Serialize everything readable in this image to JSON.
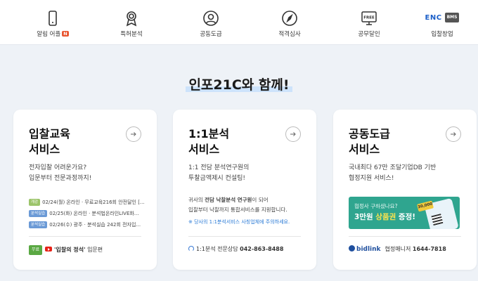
{
  "nav": {
    "items": [
      {
        "label": "알림 어플",
        "badge": "N",
        "icon": "smartphone-icon"
      },
      {
        "label": "특허분석",
        "icon": "award-icon"
      },
      {
        "label": "공동도급",
        "icon": "user-icon"
      },
      {
        "label": "적격심사",
        "icon": "compass-icon"
      },
      {
        "label": "공무달인",
        "icon": "monitor-free-icon",
        "icon_text": "FREE"
      },
      {
        "label": "입찰창업",
        "logo_text": "ENC",
        "logo_sub": "BMS"
      }
    ]
  },
  "section_title": "인포21C와 함께!",
  "cards": [
    {
      "title": "입찰교육\n서비스",
      "desc": "전자입찰 어려운가요?\n입문부터 전문과정까지!",
      "schedule": [
        {
          "tag": "개강",
          "text": "02/24(월) 온라인 · 무료교육216회 안전달인 [..."
        },
        {
          "tag": "분석실습",
          "text": "02/25(화) 온라인 · 분석법온라인LIVE화..."
        },
        {
          "tag": "분석실습",
          "text": "02/26(수) 광주 · 분석실습 242회 전자입..."
        }
      ],
      "footer": {
        "badge": "무료",
        "bold": "'입찰의 정석'",
        "text": " 입문편"
      }
    },
    {
      "title": "1:1분석\n서비스",
      "desc": "1:1 전담 분석연구원의\n투찰금액제시 컨설팅!",
      "para_prefix": "귀사의 ",
      "para_bold": "전담 낙찰분석 연구원",
      "para_suffix": "이 되어\n입찰부터 낙찰까지 통합서비스를 지원합니다.",
      "notice": "※ 당사의 1:1분석서비스 사칭업체에 주의하세요.",
      "footer": {
        "label": "1:1분석 전문상담",
        "phone": "042-863-8488"
      }
    },
    {
      "title": "공동도급\n서비스",
      "desc": "국내최다 67만 조달기업DB 기반\n협정지원 서비스!",
      "banner": {
        "line1": "협정사 구하셨나요?",
        "line2_pre": "3만원 ",
        "line2_bold": "상품권",
        "line2_post": " 증정!",
        "coin": "30,000"
      },
      "footer": {
        "brand": "bidlink",
        "label": "협정매니저",
        "phone": "1644-7818"
      }
    }
  ],
  "colors": {
    "accent": "#1a5ec8",
    "badge": "#e8542f",
    "banner": "#2fa58f",
    "highlight": "#cde3fb"
  }
}
